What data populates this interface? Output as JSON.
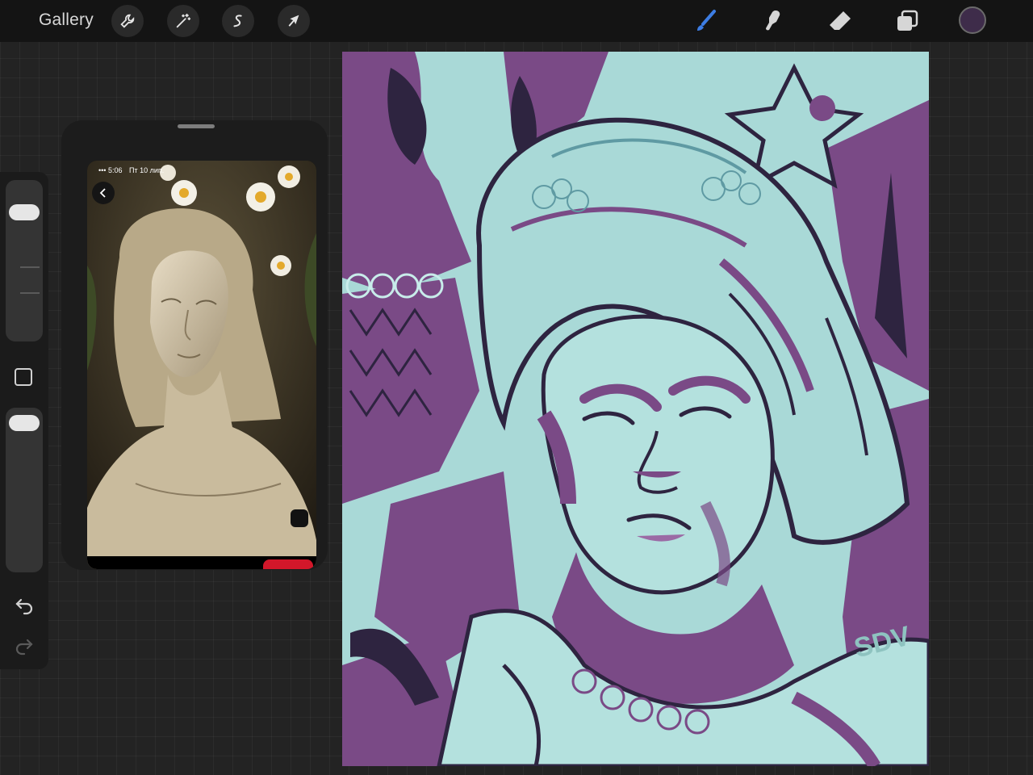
{
  "toolbar": {
    "gallery_label": "Gallery",
    "left_tools": [
      "wrench-icon",
      "magic-wand-icon",
      "selection-icon",
      "transform-arrow-icon"
    ],
    "right_tools": [
      "brush-icon",
      "smudge-icon",
      "eraser-icon",
      "layers-icon"
    ],
    "active_tool": "brush-icon",
    "active_tool_color": "#3d7de3",
    "current_color": "#3e2c4a"
  },
  "sidebar": {
    "brush_size_level": 0.15,
    "opacity_level": 0.03,
    "icons": [
      "modify-icon",
      "undo-icon",
      "redo-icon"
    ]
  },
  "reference": {
    "status_time": "5:06",
    "status_date": "Пт 10 лип."
  },
  "canvas": {
    "signature": "SDV",
    "palette": {
      "mint": "#a9d9d7",
      "pale": "#c8ecea",
      "purple": "#7a4a86",
      "deep": "#2e2440",
      "teal": "#5f9aa3"
    }
  }
}
